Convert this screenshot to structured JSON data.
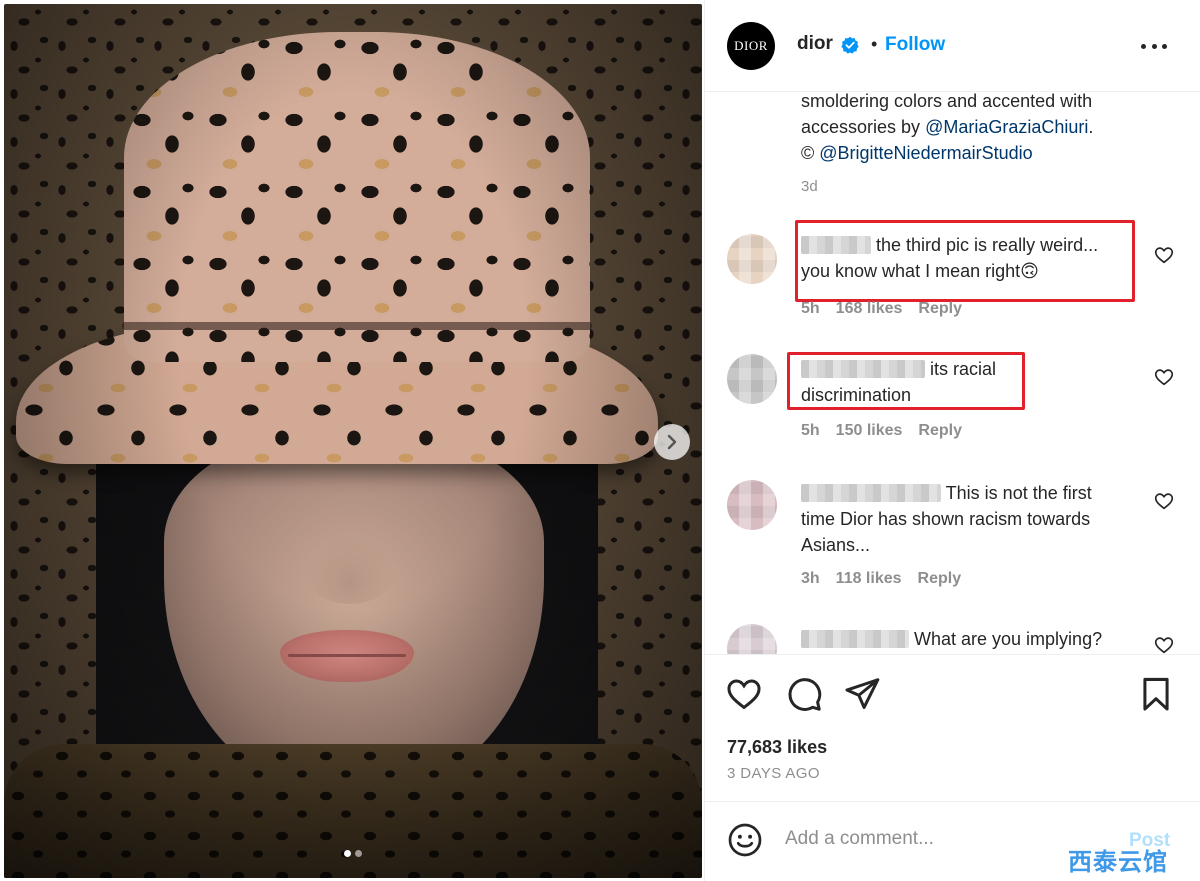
{
  "post": {
    "author": {
      "username": "dior",
      "avatar_text": "DIOR",
      "verified": true,
      "follow_label": "Follow",
      "separator": "•"
    },
    "caption": {
      "lines": [
        "smoldering colors and accented with",
        "accessories by ",
        "© "
      ],
      "mention_1": "@MariaGraziaChiuri",
      "after_mention_1": ".",
      "mention_2": "@BrigitteNiedermairStudio",
      "timestamp": "3d"
    },
    "comments": [
      {
        "text_line1": " the third pic is really weird...",
        "text_line2": "you know what I mean right",
        "emoji": "🙃",
        "time": "5h",
        "likes": "168 likes",
        "reply": "Reply",
        "highlighted": true,
        "avatar_color": "#d9c3ad"
      },
      {
        "text_line1": " its racial",
        "text_line2": "discrimination",
        "time": "5h",
        "likes": "150 likes",
        "reply": "Reply",
        "highlighted": true,
        "avatar_color": "#bdbdbd"
      },
      {
        "text_line1": " This is not the first",
        "text_line2": "time Dior has shown racism towards",
        "text_line3": "Asians...",
        "time": "3h",
        "likes": "118 likes",
        "reply": "Reply",
        "highlighted": false,
        "avatar_color": "#c9a9ad"
      },
      {
        "text_line1": " What are you implying?",
        "highlighted": false,
        "avatar_color": "#cfc3c9"
      }
    ],
    "likes_count": "77,683 likes",
    "date": "3 DAYS AGO",
    "add_comment_placeholder": "Add a comment...",
    "post_label": "Post"
  },
  "media": {
    "carousel_dots": 2,
    "active_dot": 0
  },
  "icons": {
    "heart": "heart-icon",
    "comment": "comment-icon",
    "share": "share-icon",
    "save": "bookmark-icon",
    "emoji": "emoji-icon",
    "more": "more-options-icon",
    "next": "chevron-right-icon",
    "verified": "verified-badge-icon"
  },
  "colors": {
    "link": "#0095f6",
    "mention": "#00376b",
    "muted": "#8e8e8e",
    "highlight_box": "#e0202a",
    "verified": "#0095f6"
  },
  "watermark": "西泰云馆"
}
